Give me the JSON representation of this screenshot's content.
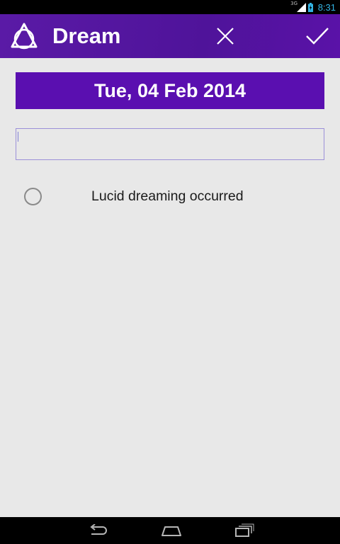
{
  "status_bar": {
    "network": "3G",
    "time": "8:31",
    "signal_icon": "signal-icon",
    "battery_icon": "battery-charging-icon",
    "time_color": "#33b5e5"
  },
  "action_bar": {
    "title": "Dream",
    "logo_icon": "triangle-circle-logo-icon",
    "cancel_icon": "close-icon",
    "confirm_icon": "check-icon",
    "accent_color": "#5a12a8"
  },
  "date_banner": {
    "date": "Tue, 04 Feb 2014",
    "background_color": "#5a0fb0"
  },
  "dream_input": {
    "value": "",
    "placeholder": ""
  },
  "lucid": {
    "label": "Lucid dreaming occurred",
    "checked": false
  },
  "nav_bar": {
    "back_icon": "back-icon",
    "home_icon": "home-icon",
    "recents_icon": "recent-apps-icon"
  }
}
